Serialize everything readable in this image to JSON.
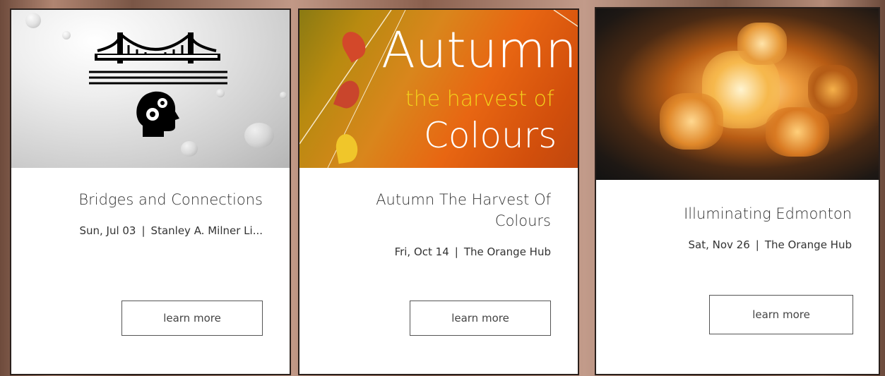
{
  "events": [
    {
      "title": "Bridges and Connections",
      "date": "Sun, Jul 03",
      "venue": "Stanley A. Milner Li...",
      "button": "learn more"
    },
    {
      "title": "Autumn The Harvest Of Colours",
      "date": "Fri, Oct 14",
      "venue": "The Orange Hub",
      "button": "learn more",
      "image_text": {
        "line1": "Autumn",
        "line2": "the harvest of",
        "line3": "Colours"
      }
    },
    {
      "title": "Illuminating Edmonton",
      "date": "Sat, Nov 26",
      "venue": "The Orange Hub",
      "button": "learn more"
    }
  ],
  "separator": "|",
  "colors": {
    "card_border": "#2a201c",
    "harvest_text": "#f2d21c",
    "autumn_bg": "#e86612"
  },
  "icons": [
    "bridge-icon",
    "head-gears-icon"
  ]
}
